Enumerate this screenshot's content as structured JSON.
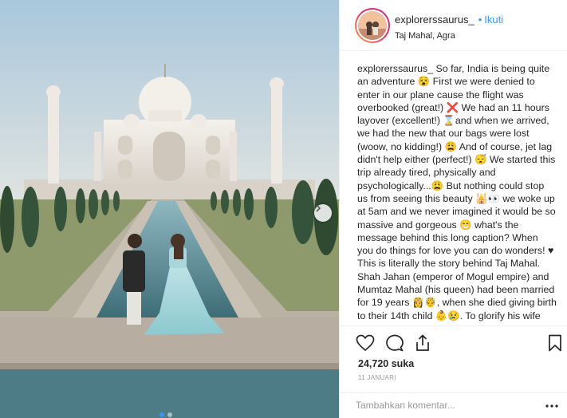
{
  "post": {
    "username": "explorerssaurus_",
    "follow_label": "Ikuti",
    "bullet": "•",
    "location": "Taj Mahal, Agra",
    "caption_user": "explorerssaurus_",
    "caption_text": "So far, India is being quite an adventure 😵 First we were denied to enter in our plane cause the flight was overbooked (great!) ❌ We had an 11 hours layover (excellent!) ⌛and when we arrived, we had the new that our bags were lost (woow, no kidding!) 😩 And of course, jet lag didn't help either (perfect!) 😴 We started this trip already tired, physically and psychologically...😩 But nothing could stop us from seeing this beauty 🕌👀 we woke up at 5am and we never imagined it would be so massive and gorgeous 😁 what's the message behind this long caption? When you do things for love you can do wonders! ♥ This is literally the story behind Taj Mahal. Shah Jahan (emperor of Mogul empire) and Mumtaz Mahal (his queen) had been married for 19 years 👸🤴, when she died giving birth to their 14th child 👶😢. To glorify his wife",
    "likes": "24,720 suka",
    "date": "11 JANUARI",
    "comment_placeholder": "Tambahkan komentar...",
    "carousel": {
      "slides": 2,
      "active_index": 1
    }
  },
  "icons": {
    "like": "heart-icon",
    "comment": "comment-icon",
    "share": "share-icon",
    "save": "bookmark-icon",
    "more": "more-options-icon",
    "next": "chevron-right-icon"
  },
  "colors": {
    "accent": "#3897f0",
    "text": "#262626",
    "muted": "#999999",
    "border": "#efefef"
  }
}
